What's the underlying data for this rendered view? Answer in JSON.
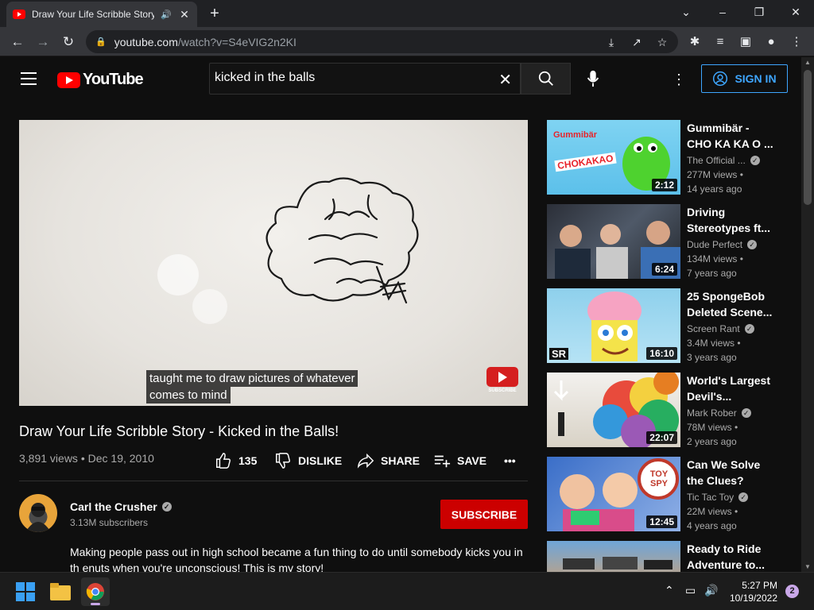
{
  "browser": {
    "tab_title": "Draw Your Life Scribble Story",
    "url_host": "youtube.com",
    "url_path": "/watch?v=S4eVIG2n2KI"
  },
  "youtube": {
    "logo_text": "YouTube",
    "search_value": "kicked in the balls",
    "sign_in_label": "SIGN IN"
  },
  "video": {
    "caption_line1": "taught me to draw pictures of whatever",
    "caption_line2": "comes to mind",
    "watermark_label": "SUBSCRIBE",
    "title": "Draw Your Life Scribble Story - Kicked in the Balls!",
    "views": "3,891 views",
    "date": "Dec 19, 2010",
    "likes": "135",
    "dislike_label": "DISLIKE",
    "share_label": "SHARE",
    "save_label": "SAVE"
  },
  "channel": {
    "name": "Carl the Crusher",
    "subscribers": "3.13M subscribers",
    "subscribe_label": "SUBSCRIBE",
    "description": "Making people pass out in high school became a fun thing to do until somebody kicks you in th enuts when you're unconscious! This is my story!"
  },
  "related": [
    {
      "title": "Gummibär - CHO KA KA O ...",
      "channel": "The Official ...",
      "views": "277M views",
      "age": "14 years ago",
      "duration": "2:12",
      "thumb_text": "CHOKAKAO"
    },
    {
      "title": "Driving Stereotypes ft...",
      "channel": "Dude Perfect",
      "views": "134M views",
      "age": "7 years ago",
      "duration": "6:24",
      "thumb_text": ""
    },
    {
      "title": "25 SpongeBob Deleted Scene...",
      "channel": "Screen Rant",
      "views": "3.4M views",
      "age": "3 years ago",
      "duration": "16:10",
      "thumb_text": "SR"
    },
    {
      "title": "World's Largest Devil's...",
      "channel": "Mark Rober",
      "views": "78M views",
      "age": "2 years ago",
      "duration": "22:07",
      "thumb_text": ""
    },
    {
      "title": "Can We Solve the Clues?",
      "channel": "Tic Tac Toy",
      "views": "22M views",
      "age": "4 years ago",
      "duration": "12:45",
      "thumb_text": "TOY SPY"
    },
    {
      "title": "Ready to Ride Adventure to...",
      "channel": "",
      "views": "",
      "age": "",
      "duration": "",
      "thumb_text": ""
    }
  ],
  "taskbar": {
    "time": "5:27 PM",
    "date": "10/19/2022",
    "notifications": "2"
  },
  "colors": {
    "brand_red": "#ff0000",
    "subscribe_red": "#cc0000",
    "link_blue": "#3ea6ff",
    "background": "#0f0f0f"
  }
}
